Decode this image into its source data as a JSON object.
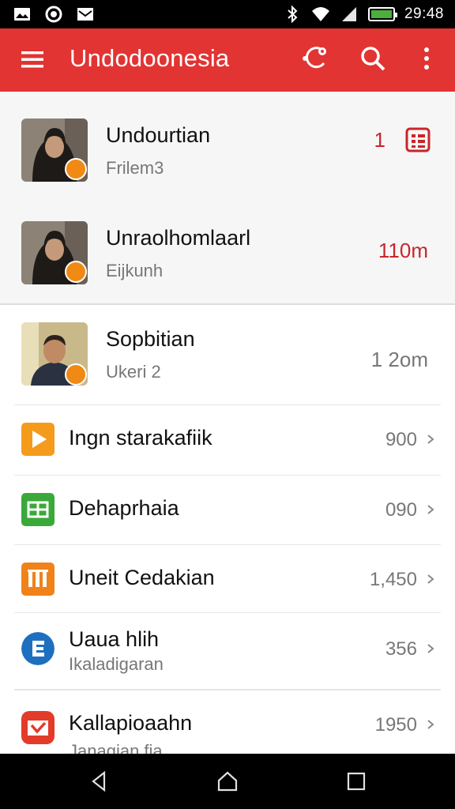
{
  "status_bar": {
    "time": "29:48",
    "left_icons": [
      "image-icon",
      "circle-notification-icon",
      "mail-icon"
    ],
    "right_icons": [
      "bluetooth-icon",
      "wifi-icon",
      "signal-icon",
      "battery-icon"
    ]
  },
  "app_bar": {
    "title": "Undodoonesia",
    "color": "#e13433"
  },
  "profiles": [
    {
      "name": "Undourtian",
      "subtitle": "Frilem3",
      "meta": "1",
      "meta_icon": "calendar-grid-icon",
      "meta_color": "#c9262a"
    },
    {
      "name": "Unraolhomlaarl",
      "subtitle": "Eijkunh",
      "meta": "110m",
      "meta_color": "#c9262a"
    },
    {
      "name": "Sopbitian",
      "subtitle": "Ukeri 2",
      "meta": "1 2om",
      "meta_color": "#777777"
    }
  ],
  "list_items": [
    {
      "label": "Ingn starakafiik",
      "value": "900",
      "icon": "play-icon",
      "icon_color": "#f49b1c"
    },
    {
      "label": "Dehaprhaia",
      "value": "090",
      "icon": "sheet-icon",
      "icon_color": "#3aa93a"
    },
    {
      "label": "Uneit Cedakian",
      "value": "1,450",
      "icon": "chart-bars-icon",
      "icon_color": "#f0821a"
    },
    {
      "label": "Uaua hlih",
      "subtitle": "Ikaladigaran",
      "value": "356",
      "icon": "letter-e-icon",
      "icon_color": "#1f6fc0"
    },
    {
      "label": "Kallapioaahn",
      "subtitle": "Janagian fia",
      "value": "1950",
      "icon": "mail-check-icon",
      "icon_color": "#e33a2a"
    }
  ]
}
